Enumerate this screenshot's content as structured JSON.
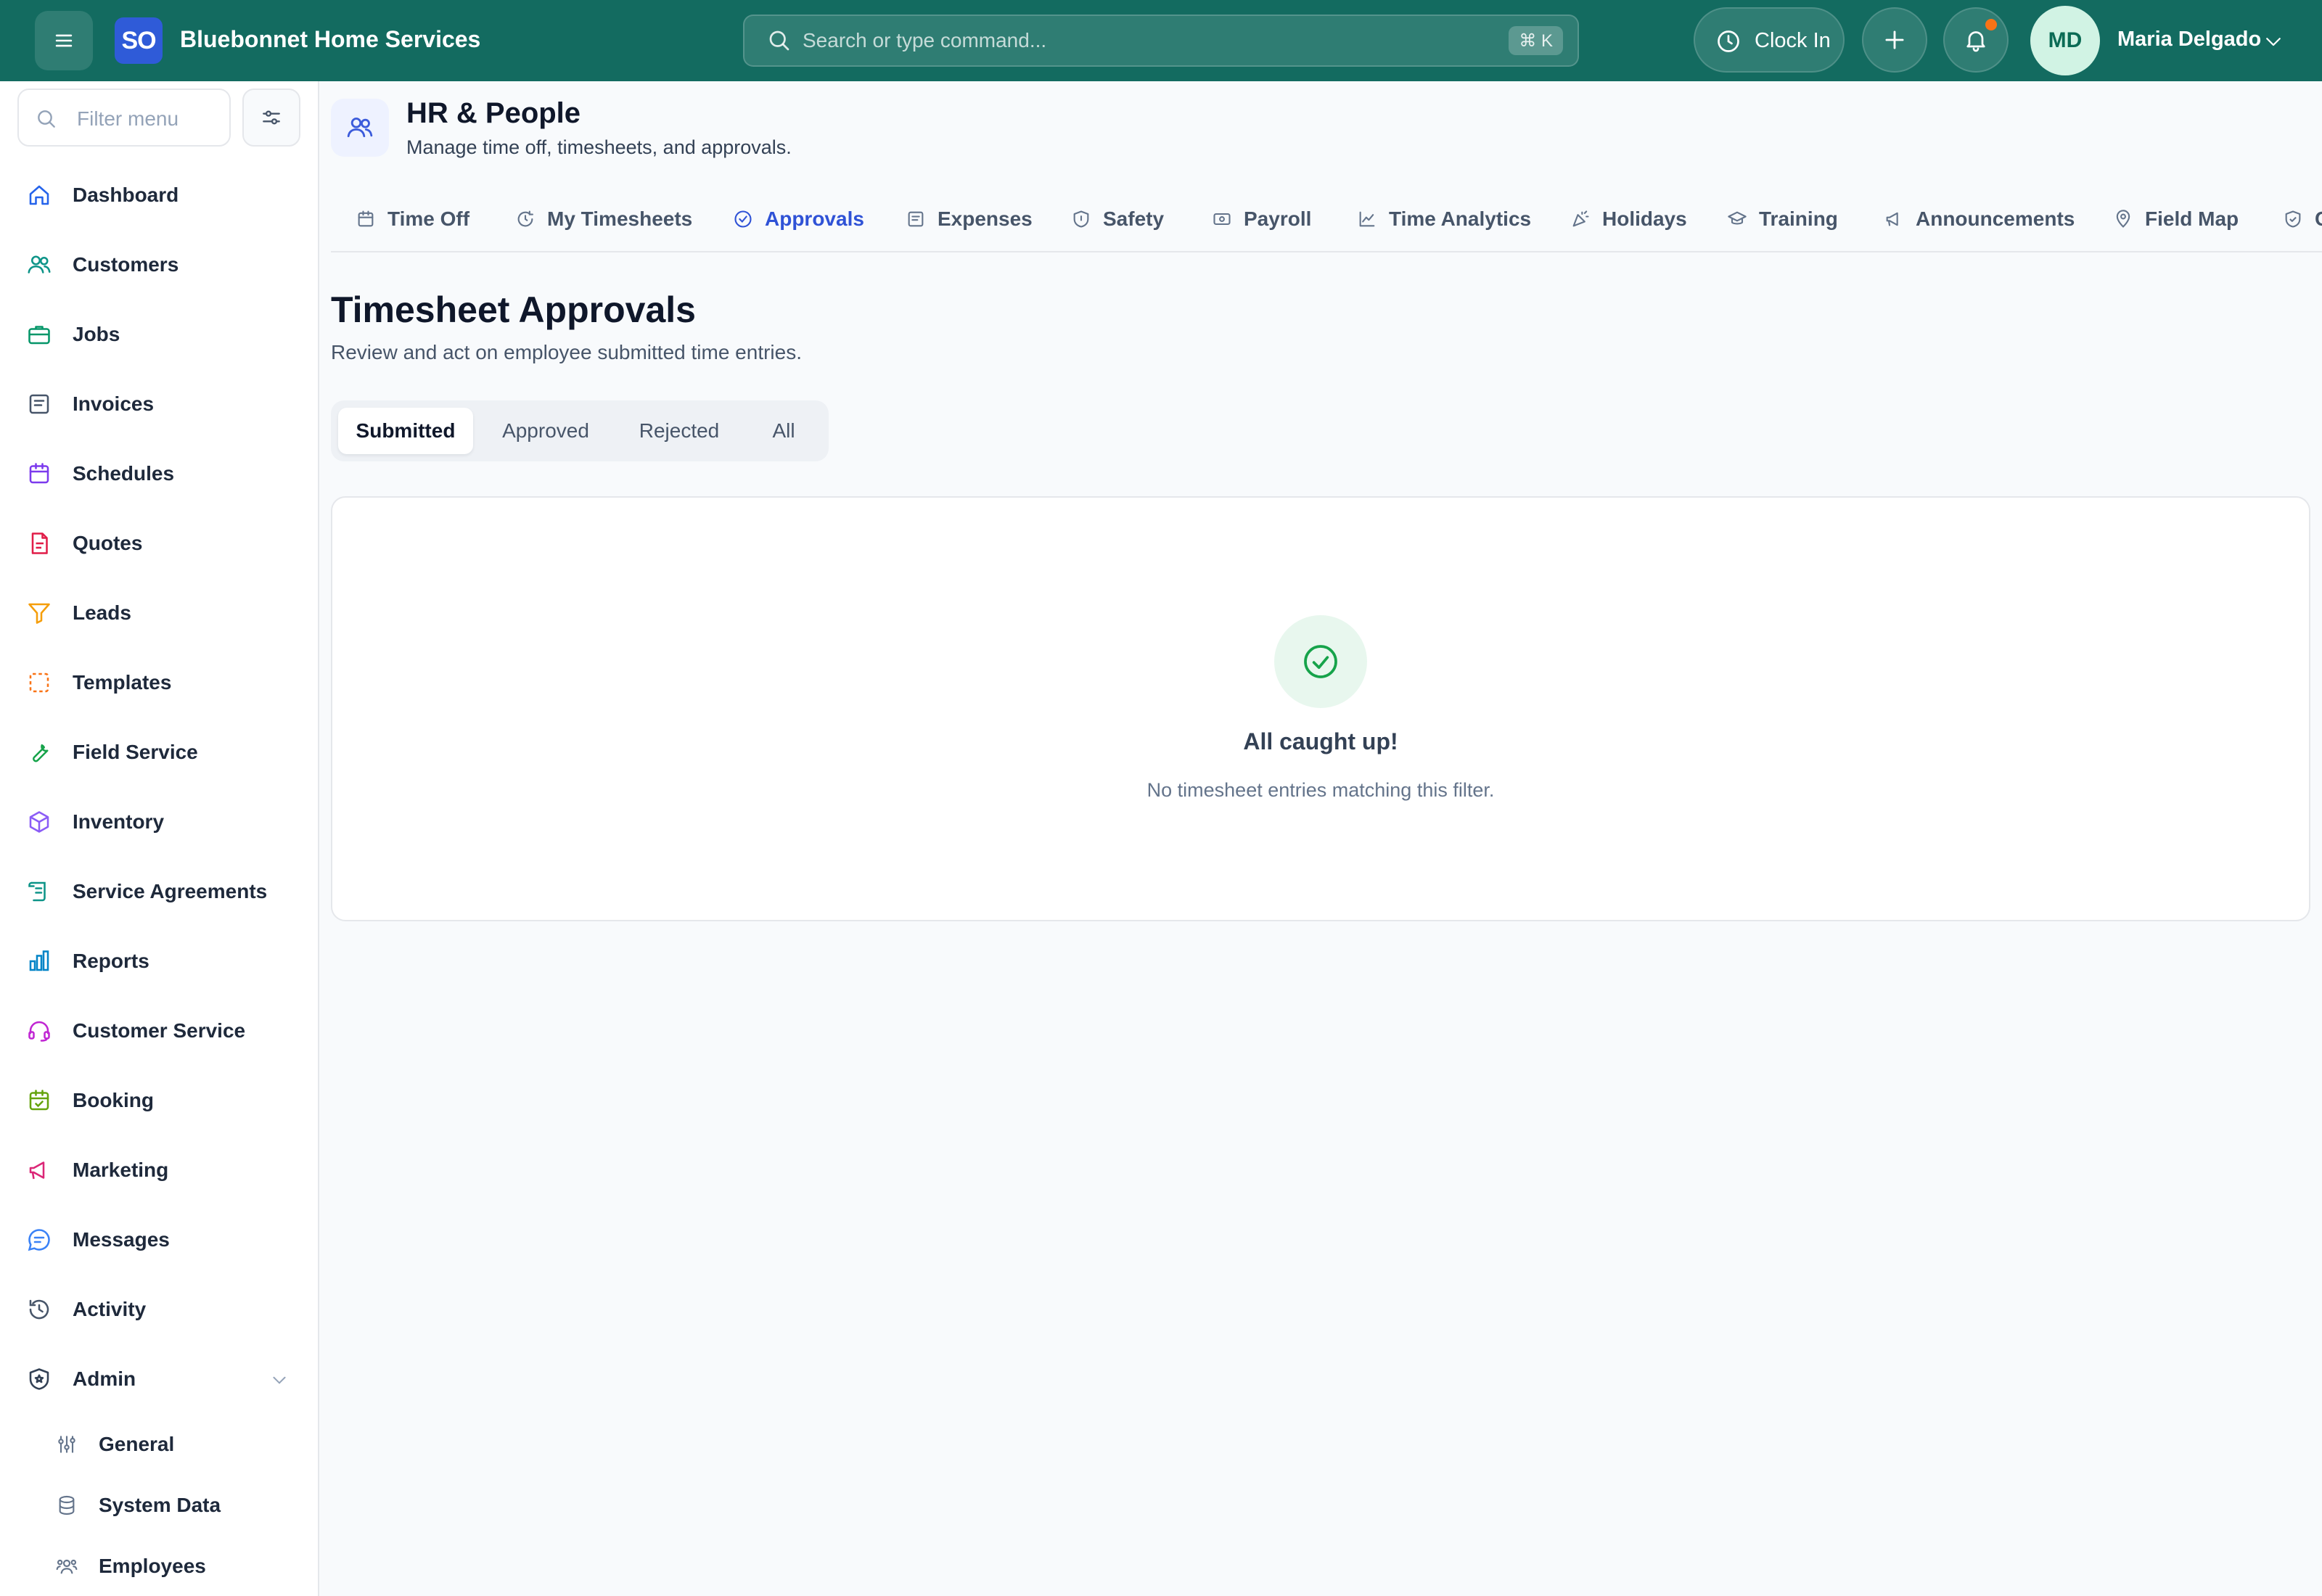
{
  "topbar": {
    "logo_text": "SO",
    "app_name": "Bluebonnet Home Services",
    "search_placeholder": "Search or type command...",
    "search_shortcut": "⌘ K",
    "clock_in_label": "Clock In",
    "user_initials": "MD",
    "user_name": "Maria Delgado",
    "accent_color": "#136b60",
    "notification_dot_color": "#f97316"
  },
  "sidebar": {
    "filter_placeholder": "Filter menu",
    "items": [
      {
        "label": "Dashboard",
        "icon": "home-icon"
      },
      {
        "label": "Customers",
        "icon": "users-icon"
      },
      {
        "label": "Jobs",
        "icon": "briefcase-icon"
      },
      {
        "label": "Invoices",
        "icon": "receipt-icon"
      },
      {
        "label": "Schedules",
        "icon": "calendar-icon"
      },
      {
        "label": "Quotes",
        "icon": "file-text-icon"
      },
      {
        "label": "Leads",
        "icon": "filter-icon"
      },
      {
        "label": "Templates",
        "icon": "template-icon"
      },
      {
        "label": "Field Service",
        "icon": "wrench-icon"
      },
      {
        "label": "Inventory",
        "icon": "box-icon"
      },
      {
        "label": "Service Agreements",
        "icon": "scroll-icon"
      },
      {
        "label": "Reports",
        "icon": "bar-chart-icon"
      },
      {
        "label": "Customer Service",
        "icon": "headset-icon"
      },
      {
        "label": "Booking",
        "icon": "calendar-check-icon"
      },
      {
        "label": "Marketing",
        "icon": "megaphone-icon"
      },
      {
        "label": "Messages",
        "icon": "message-icon"
      },
      {
        "label": "Activity",
        "icon": "history-icon"
      },
      {
        "label": "Admin",
        "icon": "shield-star-icon"
      }
    ],
    "admin_subitems": [
      {
        "label": "General",
        "icon": "sliders-icon"
      },
      {
        "label": "System Data",
        "icon": "database-icon"
      },
      {
        "label": "Employees",
        "icon": "team-icon"
      }
    ]
  },
  "page": {
    "module_title": "HR & People",
    "module_subtitle": "Manage time off, timesheets, and approvals.",
    "tabs": [
      {
        "label": "Time Off",
        "icon": "calendar-icon"
      },
      {
        "label": "My Timesheets",
        "icon": "clock-refresh-icon"
      },
      {
        "label": "Approvals",
        "icon": "check-circle-icon"
      },
      {
        "label": "Expenses",
        "icon": "receipt-icon"
      },
      {
        "label": "Safety",
        "icon": "shield-icon"
      },
      {
        "label": "Payroll",
        "icon": "banknote-icon"
      },
      {
        "label": "Time Analytics",
        "icon": "line-chart-icon"
      },
      {
        "label": "Holidays",
        "icon": "party-icon"
      },
      {
        "label": "Training",
        "icon": "graduation-cap-icon"
      },
      {
        "label": "Announcements",
        "icon": "megaphone-icon"
      },
      {
        "label": "Field Map",
        "icon": "map-pin-icon"
      },
      {
        "label": "C",
        "icon": "shield-check-icon"
      }
    ],
    "active_tab": "Approvals",
    "section_title": "Timesheet Approvals",
    "section_subtitle": "Review and act on employee submitted time entries.",
    "filters": [
      "Submitted",
      "Approved",
      "Rejected",
      "All"
    ],
    "active_filter": "Submitted",
    "empty_title": "All caught up!",
    "empty_subtitle": "No timesheet entries matching this filter."
  }
}
